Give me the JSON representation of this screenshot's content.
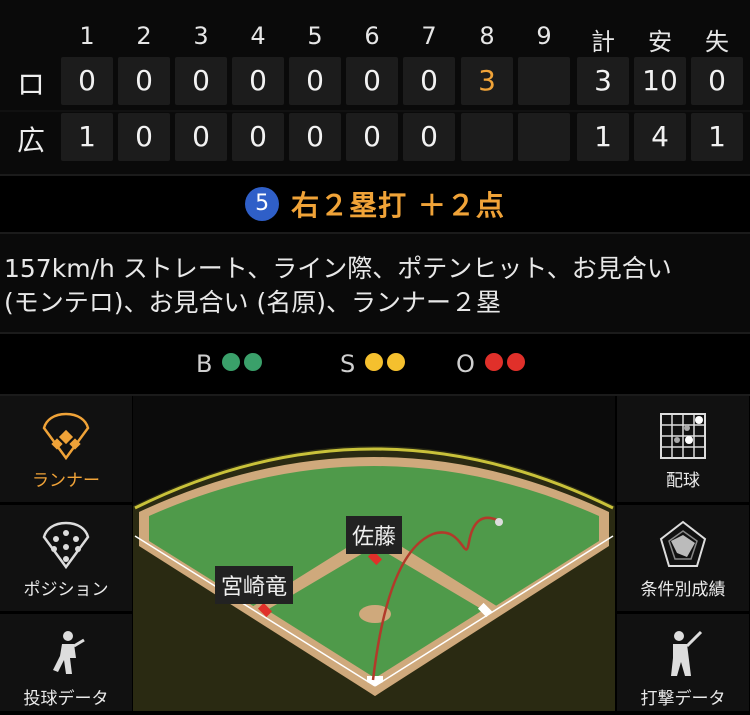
{
  "scoreboard": {
    "headers": [
      "1",
      "2",
      "3",
      "4",
      "5",
      "6",
      "7",
      "8",
      "9",
      "計",
      "安",
      "失"
    ],
    "rows": [
      {
        "team": "ロ",
        "innings": [
          "0",
          "0",
          "0",
          "0",
          "0",
          "0",
          "0",
          "3",
          ""
        ],
        "totals": [
          "3",
          "10",
          "0"
        ]
      },
      {
        "team": "広",
        "innings": [
          "1",
          "0",
          "0",
          "0",
          "0",
          "0",
          "0",
          "",
          ""
        ],
        "totals": [
          "1",
          "4",
          "1"
        ]
      }
    ],
    "highlight_color": "#f0a338"
  },
  "play": {
    "badge": "5",
    "result": "右２塁打 ＋２点"
  },
  "description": {
    "line1": "157km/h ストレート、ライン際、ポテンヒット、お見合い",
    "line2": "(モンテロ)、お見合い (名原)、ランナー２塁"
  },
  "count": {
    "ball_label": "B",
    "ball_color": "#3aa06a",
    "balls": 2,
    "strike_label": "S",
    "strike_color": "#f5c02e",
    "strikes": 2,
    "out_label": "O",
    "out_color": "#e0302a",
    "outs": 2
  },
  "left_menu": [
    {
      "label": "ランナー",
      "icon": "runner-diamond-icon",
      "active": true
    },
    {
      "label": "ポジション",
      "icon": "position-icon",
      "active": false
    },
    {
      "label": "投球データ",
      "icon": "pitcher-icon",
      "active": false
    }
  ],
  "right_menu": [
    {
      "label": "配球",
      "icon": "pitch-grid-icon"
    },
    {
      "label": "条件別成績",
      "icon": "radar-chart-icon"
    },
    {
      "label": "打撃データ",
      "icon": "batter-icon"
    }
  ],
  "field": {
    "players": [
      "佐藤",
      "宮崎竜"
    ],
    "accent": "#f0a338"
  }
}
